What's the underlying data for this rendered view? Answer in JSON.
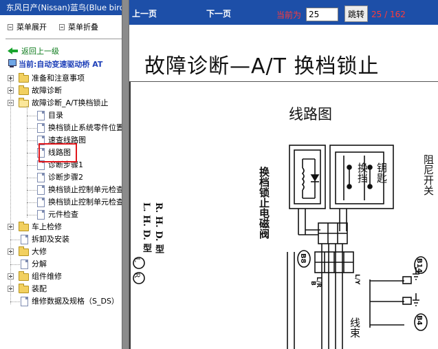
{
  "window": {
    "title": "东风日产(Nissan)蓝鸟(Blue bird)"
  },
  "menu": {
    "expand_label": "菜单展开",
    "collapse_label": "菜单折叠"
  },
  "nav": {
    "back_label": "返回上一级",
    "current_label": "当前:自动变速驱动桥 AT"
  },
  "tree": [
    {
      "label": "准备和注意事项",
      "type": "folder",
      "state": "collapsed"
    },
    {
      "label": "故障诊断",
      "type": "folder",
      "state": "collapsed"
    },
    {
      "label": "故障诊断_A/T换档锁止",
      "type": "folder",
      "state": "expanded"
    },
    {
      "label": "目录",
      "type": "doc"
    },
    {
      "label": "换档锁止系统零件位置",
      "type": "doc"
    },
    {
      "label": "速查线路图",
      "type": "doc"
    },
    {
      "label": "线路图",
      "type": "doc",
      "selected": true
    },
    {
      "label": "诊断步骤1",
      "type": "doc"
    },
    {
      "label": "诊断步骤2",
      "type": "doc"
    },
    {
      "label": "换档锁止控制单元检查",
      "type": "doc"
    },
    {
      "label": "换档锁止控制单元检查",
      "type": "doc"
    },
    {
      "label": "元件检查",
      "type": "doc"
    },
    {
      "label": "车上检修",
      "type": "folder",
      "state": "collapsed"
    },
    {
      "label": "拆卸及安装",
      "type": "doc"
    },
    {
      "label": "大修",
      "type": "folder",
      "state": "collapsed"
    },
    {
      "label": "分解",
      "type": "doc"
    },
    {
      "label": "组件维修",
      "type": "folder",
      "state": "collapsed"
    },
    {
      "label": "装配",
      "type": "folder",
      "state": "collapsed"
    },
    {
      "label": "维修数据及规格（S_DS）",
      "type": "doc"
    }
  ],
  "toolbar": {
    "prev_label": "上一页",
    "next_label": "下一页",
    "current_page_label": "当前为",
    "page_value": "25",
    "goto_label": "跳转",
    "page_count": "25 / 162"
  },
  "document": {
    "title": "故障诊断—A/T 换档锁止",
    "section_title": "线路图",
    "labels": {
      "solenoid": "换档锁止电磁阀",
      "shift": "换挡",
      "key": "钥匙",
      "park_switch": "阻尼开关",
      "lhd": "L. H. D. 型",
      "rhd": "R. H. D. 型",
      "wiring": "线束",
      "circle_l": "L",
      "circle_r": "R",
      "connector_b8": "B8",
      "connector_b14": "B14",
      "connector_b4": "B4",
      "wire_b": "B",
      "wire_lr": "L/R",
      "wire_l": "L/Y"
    }
  },
  "colors": {
    "titlebar": "#1d4fa8",
    "toolbar": "#1d4fa8",
    "page_text": "#ff3a3a",
    "selection_border": "#e0161b",
    "back_link": "#0b7a1a",
    "current_link": "#1d3fb8"
  },
  "icons": [
    "shield-icon",
    "back-arrow-icon",
    "computer-icon",
    "folder-icon",
    "document-icon",
    "plus-toggle-icon",
    "minus-toggle-icon"
  ]
}
